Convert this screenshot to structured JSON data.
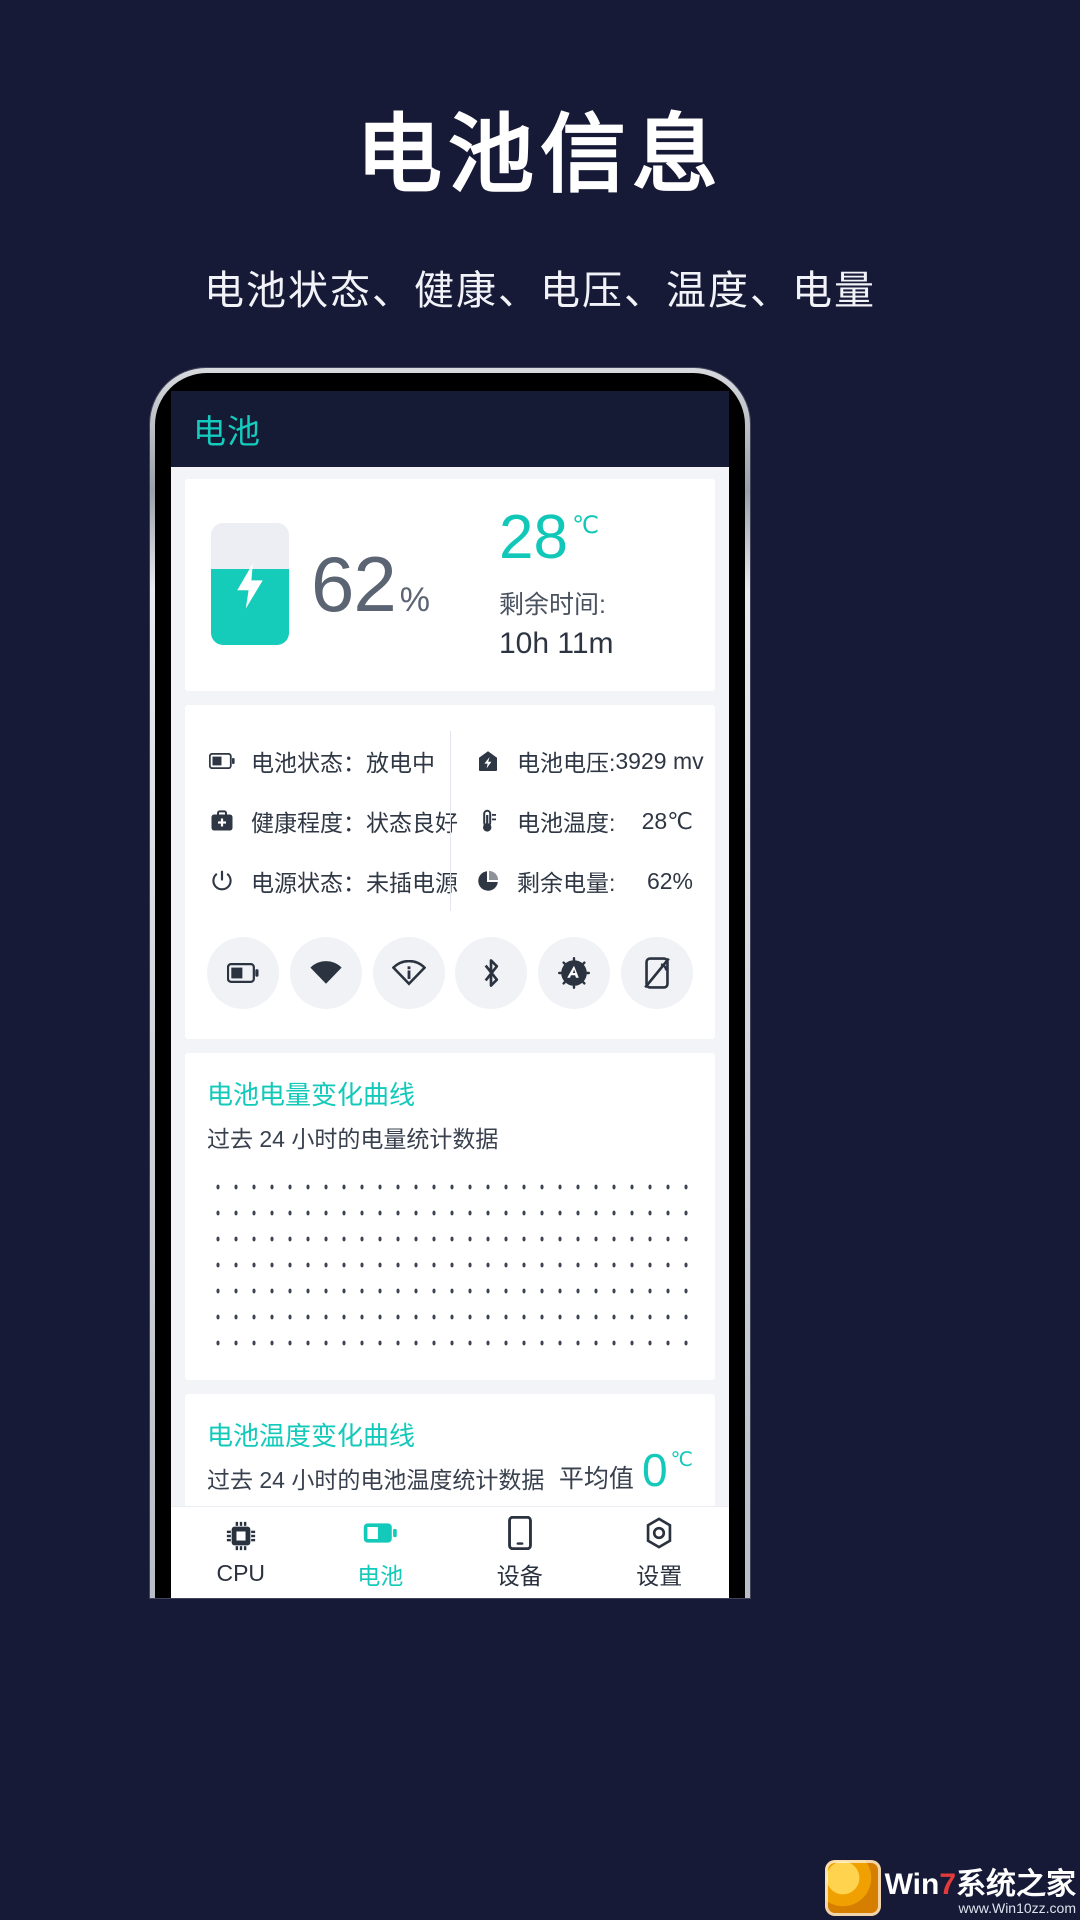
{
  "promo": {
    "title": "电池信息",
    "subtitle": "电池状态、健康、电压、温度、电量"
  },
  "app": {
    "appbar_title": "电池",
    "hero": {
      "percent_value": "62",
      "percent_symbol": "%",
      "battery_fill_percent": 62,
      "temperature_value": "28",
      "temperature_unit": "℃",
      "remaining_label": "剩余时间:",
      "remaining_value": "10h 11m"
    },
    "details": {
      "left": [
        {
          "icon": "battery-icon",
          "label": "电池状态：",
          "value": "放电中"
        },
        {
          "icon": "health-kit-icon",
          "label": "健康程度：",
          "value": "状态良好"
        },
        {
          "icon": "power-icon",
          "label": "电源状态：",
          "value": "未插电源"
        }
      ],
      "right": [
        {
          "icon": "voltage-icon",
          "label": "电池电压:",
          "value": "3929 mv"
        },
        {
          "icon": "thermometer-icon",
          "label": "电池温度:",
          "value": "28℃"
        },
        {
          "icon": "pie-chart-icon",
          "label": "剩余电量:",
          "value": "62%"
        }
      ]
    },
    "toggles": [
      {
        "icon": "battery-saver-icon"
      },
      {
        "icon": "wifi-icon"
      },
      {
        "icon": "wifi-info-icon"
      },
      {
        "icon": "bluetooth-icon"
      },
      {
        "icon": "auto-brightness-icon"
      },
      {
        "icon": "rotation-lock-icon"
      }
    ],
    "charts": [
      {
        "title": "电池电量变化曲线",
        "subtitle": "过去 24 小时的电量统计数据"
      },
      {
        "title": "电池温度变化曲线",
        "subtitle": "过去 24 小时的电池温度统计数据",
        "avg_label": "平均值",
        "avg_value": "0",
        "avg_unit": "℃"
      }
    ],
    "nav": [
      {
        "icon": "cpu-icon",
        "label": "CPU",
        "active": false
      },
      {
        "icon": "battery-icon",
        "label": "电池",
        "active": true
      },
      {
        "icon": "device-icon",
        "label": "设备",
        "active": false
      },
      {
        "icon": "settings-icon",
        "label": "设置",
        "active": false
      }
    ]
  },
  "watermark": {
    "text_pre": "Win",
    "text_num": "7",
    "text_post": "系统之家",
    "sub": "www.Win10zz.com"
  },
  "colors": {
    "background": "#161a36",
    "accent": "#13c9b9",
    "appbar": "#151a35",
    "card": "#ffffff",
    "screen_bg": "#f2f4f8"
  },
  "chart_data": [
    {
      "type": "line",
      "title": "电池电量变化曲线",
      "subtitle": "过去 24 小时的电量统计数据",
      "xlabel": "",
      "ylabel": "",
      "x": [],
      "values": [],
      "grid": true,
      "note": "空数据：仅显示点阵网格，无曲线"
    },
    {
      "type": "line",
      "title": "电池温度变化曲线",
      "subtitle": "过去 24 小时的电池温度统计数据",
      "xlabel": "",
      "ylabel": "",
      "x": [],
      "values": [],
      "average": 0,
      "average_unit": "℃",
      "grid": true,
      "note": "空数据：仅显示点阵网格，无曲线"
    }
  ]
}
